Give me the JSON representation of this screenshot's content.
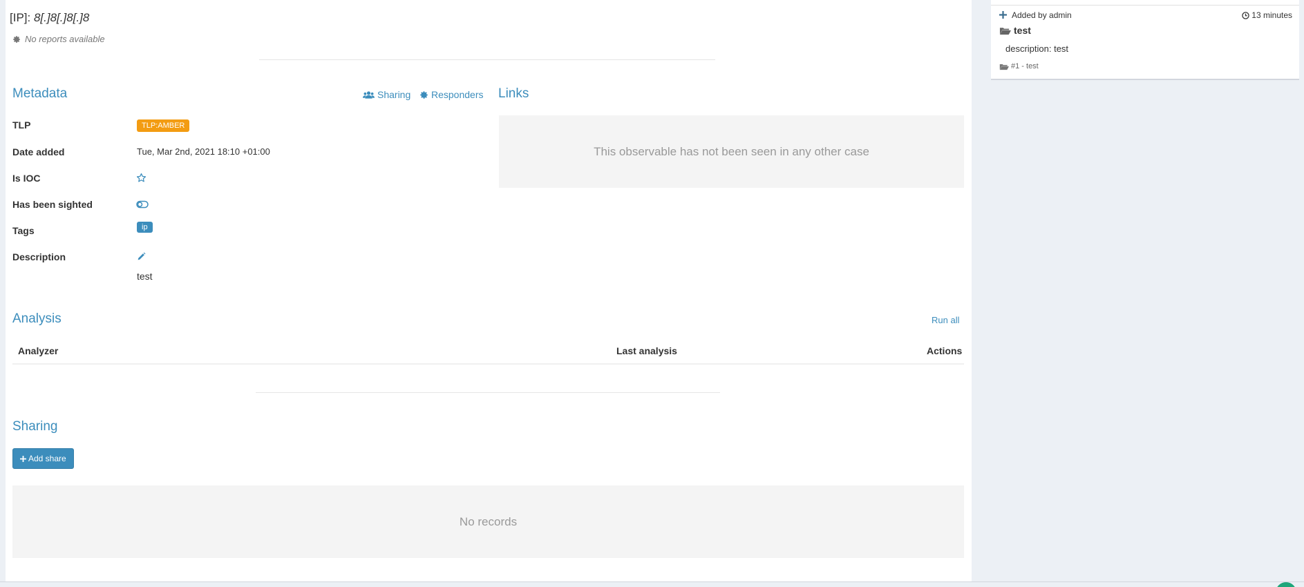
{
  "observable": {
    "type_prefix": "[IP]:",
    "value": "8[.]8[.]8[.]8",
    "no_reports": "No reports available"
  },
  "metadata": {
    "title": "Metadata",
    "sharing_link": "Sharing",
    "responders_link": "Responders",
    "rows": {
      "tlp_label": "TLP",
      "tlp_value": "TLP:AMBER",
      "date_label": "Date added",
      "date_value": "Tue, Mar 2nd, 2021 18:10 +01:00",
      "ioc_label": "Is IOC",
      "sighted_label": "Has been sighted",
      "tags_label": "Tags",
      "tag_value": "ip",
      "description_label": "Description",
      "description_value": "test"
    }
  },
  "links": {
    "title": "Links",
    "empty_message": "This observable has not been seen in any other case"
  },
  "analysis": {
    "title": "Analysis",
    "run_all": "Run all",
    "columns": [
      "Analyzer",
      "Last analysis",
      "Actions"
    ]
  },
  "sharing": {
    "title": "Sharing",
    "add_share": "Add share",
    "empty_message": "No records"
  },
  "sidebar": {
    "added_by": "Added by admin",
    "time_ago": "13 minutes",
    "case_name": "test",
    "description": "description: test",
    "case_ref": "#1 - test"
  },
  "colors": {
    "accent": "#3c8dbc",
    "tlp_amber": "#f39c12"
  }
}
